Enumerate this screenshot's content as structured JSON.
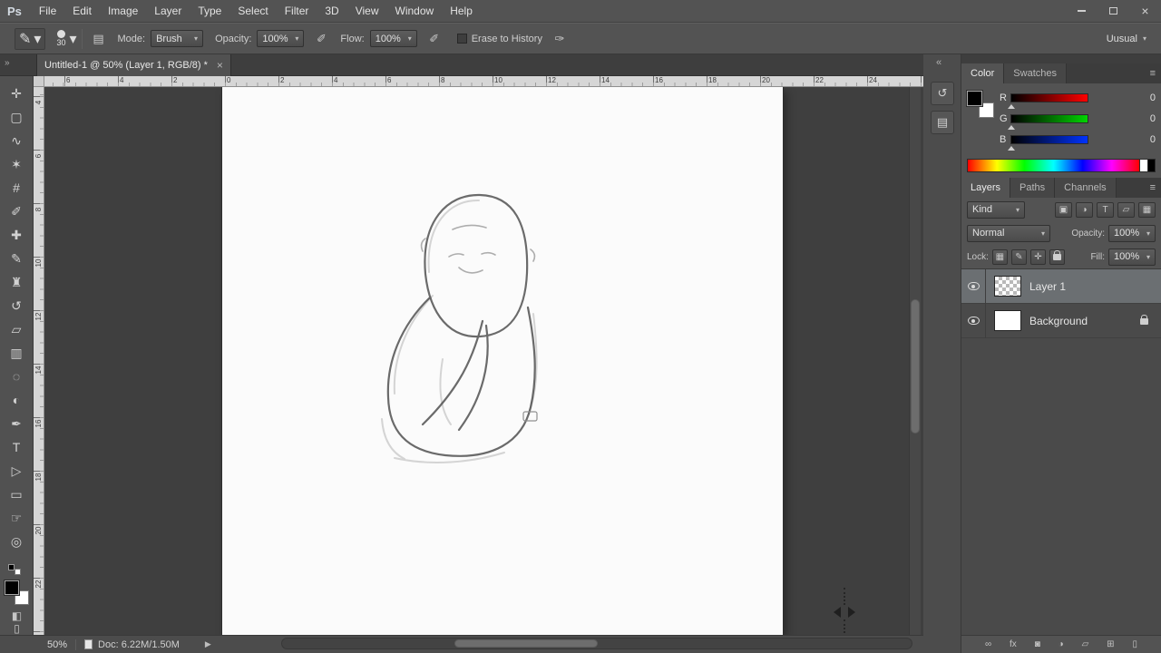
{
  "window": {
    "logo": "Ps"
  },
  "menu": {
    "items": [
      "File",
      "Edit",
      "Image",
      "Layer",
      "Type",
      "Select",
      "Filter",
      "3D",
      "View",
      "Window",
      "Help"
    ]
  },
  "options_bar": {
    "brush_size": "30",
    "mode_label": "Mode:",
    "mode_value": "Brush",
    "opacity_label": "Opacity:",
    "opacity_value": "100%",
    "flow_label": "Flow:",
    "flow_value": "100%",
    "erase_to_history_label": "Erase to History",
    "workspace_value": "Uusual"
  },
  "document_tab": {
    "title": "Untitled-1 @ 50% (Layer 1, RGB/8) *",
    "close_glyph": "×"
  },
  "toolbar": {
    "tools": [
      {
        "name": "move-tool",
        "glyph": "✛"
      },
      {
        "name": "rectangular-marquee-tool",
        "glyph": "▢"
      },
      {
        "name": "lasso-tool",
        "glyph": "∿"
      },
      {
        "name": "quick-selection-tool",
        "glyph": "✶"
      },
      {
        "name": "crop-tool",
        "glyph": "#"
      },
      {
        "name": "eyedropper-tool",
        "glyph": "✐"
      },
      {
        "name": "healing-brush-tool",
        "glyph": "✚"
      },
      {
        "name": "brush-tool",
        "glyph": "✎"
      },
      {
        "name": "clone-stamp-tool",
        "glyph": "♜"
      },
      {
        "name": "history-brush-tool",
        "glyph": "↺"
      },
      {
        "name": "eraser-tool",
        "glyph": "▱"
      },
      {
        "name": "gradient-tool",
        "glyph": "▥"
      },
      {
        "name": "blur-tool",
        "glyph": "◌"
      },
      {
        "name": "dodge-tool",
        "glyph": "◐"
      },
      {
        "name": "pen-tool",
        "glyph": "✒"
      },
      {
        "name": "type-tool",
        "glyph": "T"
      },
      {
        "name": "path-selection-tool",
        "glyph": "▷"
      },
      {
        "name": "rectangle-tool",
        "glyph": "▭"
      },
      {
        "name": "hand-tool",
        "glyph": "☞"
      },
      {
        "name": "zoom-tool",
        "glyph": "◎"
      }
    ]
  },
  "rulers": {
    "top": [
      "6",
      "4",
      "2",
      "0",
      "2",
      "4",
      "6",
      "8",
      "10",
      "12",
      "14",
      "16",
      "18",
      "20",
      "22",
      "24"
    ],
    "left": [
      "4",
      "6",
      "8",
      "10",
      "12",
      "14",
      "16",
      "18",
      "20",
      "22"
    ]
  },
  "color_panel": {
    "tabs": [
      "Color",
      "Swatches"
    ],
    "channels": [
      {
        "label": "R",
        "value": "0"
      },
      {
        "label": "G",
        "value": "0"
      },
      {
        "label": "B",
        "value": "0"
      }
    ]
  },
  "layers_panel": {
    "tabs": [
      "Layers",
      "Paths",
      "Channels"
    ],
    "kind_label": "Kind",
    "blend_mode": "Normal",
    "opacity_label": "Opacity:",
    "opacity_value": "100%",
    "lock_label": "Lock:",
    "fill_label": "Fill:",
    "fill_value": "100%",
    "layers": [
      {
        "name": "Layer 1",
        "selected": true,
        "thumb": "transparent",
        "locked": false
      },
      {
        "name": "Background",
        "selected": false,
        "thumb": "white",
        "locked": true
      }
    ]
  },
  "status_bar": {
    "zoom": "50%",
    "doc_info": "Doc: 6.22M/1.50M"
  },
  "icons": {
    "panel_menu": "≡",
    "dropdown_arrow": "▾",
    "toolbar_collapse": "»",
    "dock_collapse": "«",
    "history_panel": "↺",
    "properties_panel": "▤",
    "brush_panel_toggle": "▤",
    "tool_preset_brush": "✎",
    "airbrush": "✐",
    "pressure_size": "✑",
    "filter_pixel": "▣",
    "filter_adjustment": "◑",
    "filter_type": "T",
    "filter_shape": "▱",
    "filter_smart": "▦",
    "lock_transparent": "▦",
    "lock_pixels": "✎",
    "lock_position": "✛",
    "link_layers": "∞",
    "layer_fx": "fx",
    "layer_mask": "◙",
    "layer_adjustment": "◑",
    "layer_group": "▱",
    "layer_new": "⊞",
    "layer_delete": "▯",
    "status_arrow": "▶",
    "quick_mask": "◧",
    "screen_mode": "▯"
  }
}
